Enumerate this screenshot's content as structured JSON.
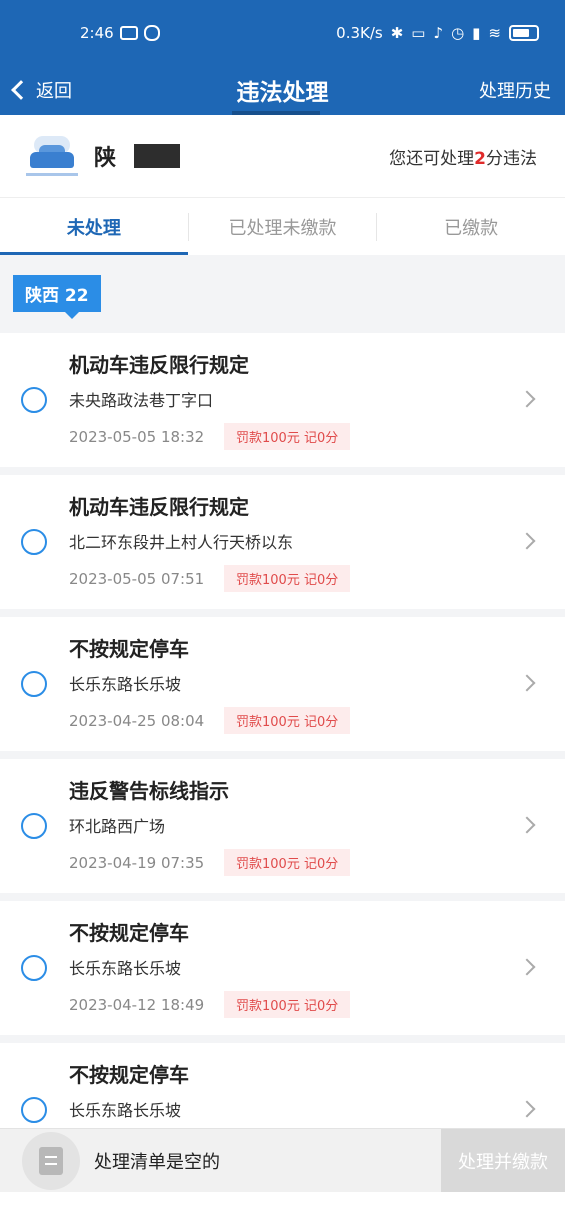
{
  "status_bar": {
    "time": "2:46",
    "network_speed": "0.3K/s",
    "icons": [
      "app-notification-icon",
      "app-notification-icon",
      "bluetooth-icon",
      "vibrate-icon",
      "mute-icon",
      "alarm-icon",
      "signal-icon",
      "wifi-icon",
      "battery-icon"
    ]
  },
  "nav": {
    "back_label": "返回",
    "title": "违法处理",
    "history_label": "处理历史"
  },
  "vehicle": {
    "plate_prefix": "陕",
    "remaining_prefix": "您还可处理",
    "remaining_count": "2",
    "remaining_suffix": "分违法"
  },
  "tabs": [
    {
      "label": "未处理",
      "active": true
    },
    {
      "label": "已处理未缴款",
      "active": false
    },
    {
      "label": "已缴款",
      "active": false
    }
  ],
  "region": {
    "label": "陕西 22"
  },
  "violations": [
    {
      "title": "机动车违反限行规定",
      "location": "未央路政法巷丁字口",
      "datetime": "2023-05-05 18:32",
      "fine": "罚款100元 记0分"
    },
    {
      "title": "机动车违反限行规定",
      "location": "北二环东段井上村人行天桥以东",
      "datetime": "2023-05-05 07:51",
      "fine": "罚款100元 记0分"
    },
    {
      "title": "不按规定停车",
      "location": "长乐东路长乐坡",
      "datetime": "2023-04-25 08:04",
      "fine": "罚款100元 记0分"
    },
    {
      "title": "违反警告标线指示",
      "location": "环北路西广场",
      "datetime": "2023-04-19 07:35",
      "fine": "罚款100元 记0分"
    },
    {
      "title": "不按规定停车",
      "location": "长乐东路长乐坡",
      "datetime": "2023-04-12 18:49",
      "fine": "罚款100元 记0分"
    },
    {
      "title": "不按规定停车",
      "location": "长乐东路长乐坡",
      "datetime": "",
      "fine": ""
    }
  ],
  "bottom_bar": {
    "empty_text": "处理清单是空的",
    "pay_label": "处理并缴款"
  },
  "colors": {
    "header": "#1e67b5",
    "accent": "#2b8de6",
    "fine_text": "#e04b4b",
    "remaining_count": "#e02b2b"
  }
}
